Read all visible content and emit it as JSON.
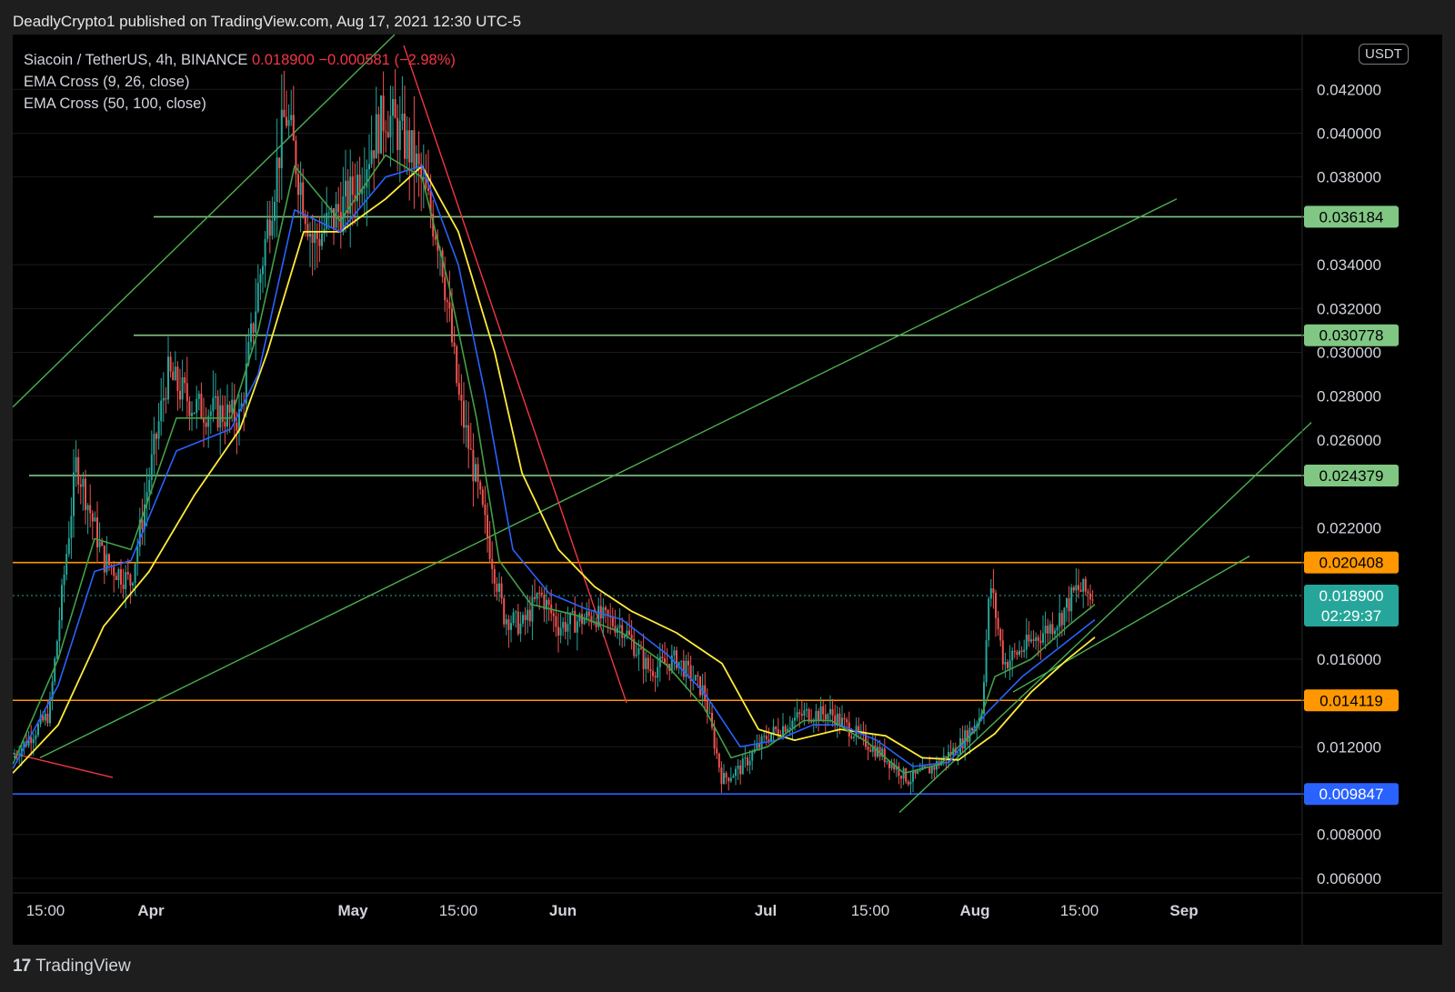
{
  "header": {
    "published": "DeadlyCrypto1 published on TradingView.com, Aug 17, 2021 12:30 UTC-5"
  },
  "legend": {
    "symbol": "Siacoin / TetherUS, 4h, BINANCE",
    "price": "0.018900",
    "change": "−0.000581 (−2.98%)",
    "ind1": "EMA Cross (9, 26, close)",
    "ind2": "EMA Cross (50, 100, close)"
  },
  "unit_label": "USDT",
  "footer": {
    "brand": "TradingView"
  },
  "colors": {
    "up": "#26a69a",
    "down": "#ef5350",
    "ema9": "#43a047",
    "ema26": "#2962ff",
    "ema50": "#ffeb3b",
    "trend_green": "#4caf50",
    "trend_red": "#f23645"
  },
  "chart_data": {
    "type": "candlestick",
    "y_scale": "linear",
    "ylim": [
      0.0055,
      0.0445
    ],
    "y_ticks": [
      "0.006000",
      "0.008000",
      "0.012000",
      "0.016000",
      "0.022000",
      "0.026000",
      "0.028000",
      "0.030000",
      "0.032000",
      "0.034000",
      "0.038000",
      "0.040000",
      "0.042000"
    ],
    "x_ticks": [
      "15:00",
      "Apr",
      "May",
      "15:00",
      "Jun",
      "Jul",
      "15:00",
      "Aug",
      "15:00",
      "Sep"
    ],
    "horizontal_levels": [
      {
        "value": 0.036184,
        "label": "0.036184",
        "color": "#81c784",
        "kind": "green"
      },
      {
        "value": 0.030778,
        "label": "0.030778",
        "color": "#81c784",
        "kind": "green"
      },
      {
        "value": 0.024379,
        "label": "0.024379",
        "color": "#81c784",
        "kind": "green"
      },
      {
        "value": 0.020408,
        "label": "0.020408",
        "color": "#ff9800",
        "kind": "orange"
      },
      {
        "value": 0.014119,
        "label": "0.014119",
        "color": "#ff9800",
        "kind": "orange"
      },
      {
        "value": 0.009847,
        "label": "0.009847",
        "color": "#2962ff",
        "kind": "blue"
      }
    ],
    "last_price": {
      "value": 0.0189,
      "label": "0.018900",
      "countdown": "02:29:37",
      "color": "#26a69a"
    },
    "price_path": [
      [
        0,
        0.0115
      ],
      [
        40,
        0.0135
      ],
      [
        70,
        0.025
      ],
      [
        100,
        0.0205
      ],
      [
        130,
        0.0195
      ],
      [
        170,
        0.029
      ],
      [
        200,
        0.0275
      ],
      [
        250,
        0.027
      ],
      [
        270,
        0.033
      ],
      [
        300,
        0.041
      ],
      [
        330,
        0.035
      ],
      [
        370,
        0.037
      ],
      [
        410,
        0.041
      ],
      [
        440,
        0.039
      ],
      [
        470,
        0.035
      ],
      [
        490,
        0.028
      ],
      [
        520,
        0.022
      ],
      [
        540,
        0.018
      ],
      [
        560,
        0.0175
      ],
      [
        580,
        0.019
      ],
      [
        600,
        0.0175
      ],
      [
        640,
        0.018
      ],
      [
        670,
        0.0175
      ],
      [
        700,
        0.0155
      ],
      [
        730,
        0.016
      ],
      [
        760,
        0.0145
      ],
      [
        780,
        0.0105
      ],
      [
        800,
        0.011
      ],
      [
        830,
        0.0125
      ],
      [
        870,
        0.0135
      ],
      [
        900,
        0.0135
      ],
      [
        930,
        0.0125
      ],
      [
        960,
        0.0115
      ],
      [
        985,
        0.0105
      ],
      [
        1010,
        0.011
      ],
      [
        1040,
        0.012
      ],
      [
        1065,
        0.0135
      ],
      [
        1075,
        0.0195
      ],
      [
        1090,
        0.0158
      ],
      [
        1120,
        0.0168
      ],
      [
        1150,
        0.0178
      ],
      [
        1170,
        0.0192
      ],
      [
        1190,
        0.0189
      ]
    ],
    "ema9": [
      [
        0,
        0.0112
      ],
      [
        50,
        0.016
      ],
      [
        90,
        0.0215
      ],
      [
        130,
        0.021
      ],
      [
        180,
        0.027
      ],
      [
        240,
        0.027
      ],
      [
        270,
        0.031
      ],
      [
        310,
        0.0385
      ],
      [
        360,
        0.036
      ],
      [
        410,
        0.039
      ],
      [
        450,
        0.038
      ],
      [
        480,
        0.033
      ],
      [
        510,
        0.027
      ],
      [
        535,
        0.0205
      ],
      [
        570,
        0.0185
      ],
      [
        620,
        0.018
      ],
      [
        670,
        0.0172
      ],
      [
        720,
        0.0157
      ],
      [
        760,
        0.0138
      ],
      [
        790,
        0.0115
      ],
      [
        830,
        0.012
      ],
      [
        870,
        0.0132
      ],
      [
        900,
        0.0132
      ],
      [
        940,
        0.0122
      ],
      [
        980,
        0.0108
      ],
      [
        1020,
        0.0112
      ],
      [
        1060,
        0.0128
      ],
      [
        1080,
        0.0152
      ],
      [
        1120,
        0.016
      ],
      [
        1160,
        0.0175
      ],
      [
        1190,
        0.0185
      ]
    ],
    "ema26": [
      [
        0,
        0.011
      ],
      [
        50,
        0.0148
      ],
      [
        90,
        0.02
      ],
      [
        130,
        0.0205
      ],
      [
        180,
        0.0255
      ],
      [
        240,
        0.0265
      ],
      [
        270,
        0.029
      ],
      [
        310,
        0.0365
      ],
      [
        360,
        0.0355
      ],
      [
        410,
        0.038
      ],
      [
        450,
        0.0385
      ],
      [
        490,
        0.034
      ],
      [
        520,
        0.028
      ],
      [
        550,
        0.021
      ],
      [
        590,
        0.019
      ],
      [
        630,
        0.0183
      ],
      [
        670,
        0.0178
      ],
      [
        720,
        0.0162
      ],
      [
        760,
        0.0145
      ],
      [
        800,
        0.012
      ],
      [
        840,
        0.0123
      ],
      [
        880,
        0.013
      ],
      [
        910,
        0.013
      ],
      [
        950,
        0.0123
      ],
      [
        990,
        0.0111
      ],
      [
        1030,
        0.0113
      ],
      [
        1070,
        0.0135
      ],
      [
        1110,
        0.0152
      ],
      [
        1150,
        0.0165
      ],
      [
        1190,
        0.0178
      ]
    ],
    "ema50": [
      [
        0,
        0.0108
      ],
      [
        50,
        0.013
      ],
      [
        100,
        0.0175
      ],
      [
        150,
        0.02
      ],
      [
        200,
        0.0235
      ],
      [
        250,
        0.0265
      ],
      [
        280,
        0.03
      ],
      [
        320,
        0.0355
      ],
      [
        360,
        0.0355
      ],
      [
        410,
        0.037
      ],
      [
        450,
        0.0385
      ],
      [
        490,
        0.0355
      ],
      [
        530,
        0.03
      ],
      [
        560,
        0.0245
      ],
      [
        600,
        0.021
      ],
      [
        640,
        0.0193
      ],
      [
        680,
        0.0182
      ],
      [
        730,
        0.0172
      ],
      [
        780,
        0.0158
      ],
      [
        820,
        0.0128
      ],
      [
        860,
        0.0123
      ],
      [
        910,
        0.0128
      ],
      [
        960,
        0.0125
      ],
      [
        1000,
        0.0115
      ],
      [
        1040,
        0.0114
      ],
      [
        1080,
        0.0126
      ],
      [
        1120,
        0.0145
      ],
      [
        1160,
        0.016
      ],
      [
        1190,
        0.017
      ]
    ],
    "trendlines": [
      {
        "color": "green",
        "from": [
          0,
          0.0275
        ],
        "to": [
          420,
          0.0445
        ]
      },
      {
        "color": "green",
        "from": [
          30,
          0.0115
        ],
        "to": [
          1280,
          0.037
        ]
      },
      {
        "color": "green",
        "from": [
          975,
          0.009
        ],
        "to": [
          1428,
          0.0268
        ]
      },
      {
        "color": "green",
        "from": [
          1100,
          0.0145
        ],
        "to": [
          1360,
          0.0207
        ]
      },
      {
        "color": "red",
        "from": [
          430,
          0.044
        ],
        "to": [
          675,
          0.014
        ]
      },
      {
        "color": "red",
        "from": [
          0,
          0.0117
        ],
        "to": [
          110,
          0.0106
        ]
      }
    ],
    "horizontal_level_spans": [
      [
        155,
        1428
      ],
      [
        133,
        1428
      ],
      [
        18,
        1428
      ],
      [
        0,
        1428
      ],
      [
        0,
        1428
      ],
      [
        0,
        1428
      ]
    ]
  }
}
